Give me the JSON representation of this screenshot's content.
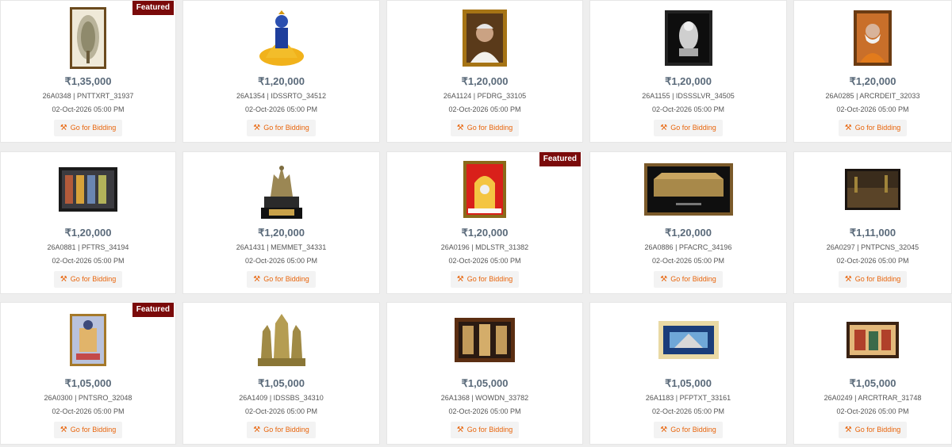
{
  "featured_label": "Featured",
  "bid_label": "Go for Bidding",
  "bid_icon": "gavel-icon",
  "colors": {
    "price": "#5a6a7a",
    "accent": "#e8650c",
    "badge": "#7a0a0a"
  },
  "lots": [
    {
      "price": "₹1,35,000",
      "code": "26A0348 | PNTTXRT_31937",
      "date": "02-Oct-2026 05:00 PM",
      "featured": true,
      "art": "painting-tree"
    },
    {
      "price": "₹1,20,000",
      "code": "26A1354 | IDSSRTO_34512",
      "date": "02-Oct-2026 05:00 PM",
      "featured": false,
      "art": "idol-yellow"
    },
    {
      "price": "₹1,20,000",
      "code": "26A1124 | PFDRG_33105",
      "date": "02-Oct-2026 05:00 PM",
      "featured": false,
      "art": "portrait-frame"
    },
    {
      "price": "₹1,20,000",
      "code": "26A1155 | IDSSSLVR_34505",
      "date": "02-Oct-2026 05:00 PM",
      "featured": false,
      "art": "silver-frame"
    },
    {
      "price": "₹1,20,000",
      "code": "26A0285 | ARCRDEIT_32033",
      "date": "02-Oct-2026 05:00 PM",
      "featured": false,
      "art": "portrait-orange"
    },
    {
      "price": "₹1,20,000",
      "code": "26A0881 | PFTRS_34194",
      "date": "02-Oct-2026 05:00 PM",
      "featured": false,
      "art": "panel-dark"
    },
    {
      "price": "₹1,20,000",
      "code": "26A1431 | MEMMET_34331",
      "date": "02-Oct-2026 05:00 PM",
      "featured": false,
      "art": "trophy"
    },
    {
      "price": "₹1,20,000",
      "code": "26A0196 | MDLSTR_31382",
      "date": "02-Oct-2026 05:00 PM",
      "featured": true,
      "art": "red-shrine"
    },
    {
      "price": "₹1,20,000",
      "code": "26A0886 | PFACRC_34196",
      "date": "02-Oct-2026 05:00 PM",
      "featured": false,
      "art": "wide-gold"
    },
    {
      "price": "₹1,11,000",
      "code": "26A0297 | PNTPCNS_32045",
      "date": "02-Oct-2026 05:00 PM",
      "featured": false,
      "art": "landscape-dark"
    },
    {
      "price": "₹1,05,000",
      "code": "26A0300 | PNTSRO_32048",
      "date": "02-Oct-2026 05:00 PM",
      "featured": true,
      "art": "painting-blue"
    },
    {
      "price": "₹1,05,000",
      "code": "26A1409 | IDSSBS_34310",
      "date": "02-Oct-2026 05:00 PM",
      "featured": false,
      "art": "brass-idols"
    },
    {
      "price": "₹1,05,000",
      "code": "26A1368 | WOWDN_33782",
      "date": "02-Oct-2026 05:00 PM",
      "featured": false,
      "art": "wood-carving"
    },
    {
      "price": "₹1,05,000",
      "code": "26A1183 | PFPTXT_33161",
      "date": "02-Oct-2026 05:00 PM",
      "featured": false,
      "art": "temple-frame"
    },
    {
      "price": "₹1,05,000",
      "code": "26A0249 | ARCRTRAR_31748",
      "date": "02-Oct-2026 05:00 PM",
      "featured": false,
      "art": "painting-small"
    }
  ]
}
